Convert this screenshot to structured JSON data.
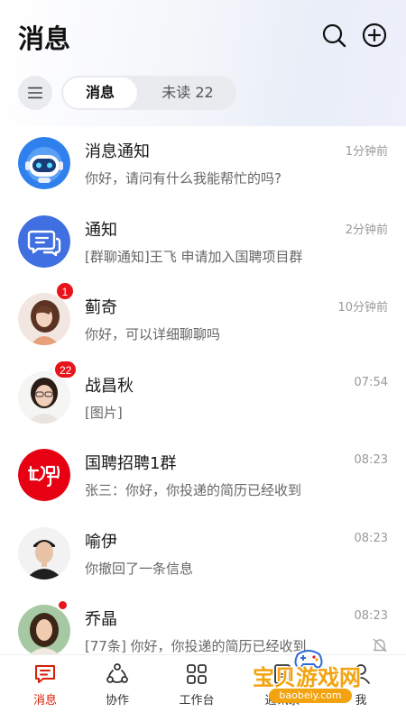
{
  "header": {
    "title": "消息"
  },
  "filter": {
    "tabs": [
      {
        "label": "消息"
      },
      {
        "label": "未读 22"
      }
    ]
  },
  "conversations": [
    {
      "name": "消息通知",
      "preview": "你好，请问有什么我能帮忙的吗?",
      "time": "1分钟前",
      "avatar": "robot-avatar"
    },
    {
      "name": "通知",
      "preview": "[群聊通知]王飞 申请加入国聘项目群",
      "time": "2分钟前",
      "avatar": "chat-notification-avatar"
    },
    {
      "name": "蓟奇",
      "preview": "你好，可以详细聊聊吗",
      "time": "10分钟前",
      "badge": "1",
      "avatar": "user-photo"
    },
    {
      "name": "战昌秋",
      "preview": "[图片]",
      "time": "07:54",
      "badge": "22",
      "avatar": "user-photo"
    },
    {
      "name": "国聘招聘1群",
      "preview": "张三：你好，你投递的简历已经收到",
      "time": "08:23",
      "avatar": "guopin-logo"
    },
    {
      "name": "喻伊",
      "preview": "你撤回了一条信息",
      "time": "08:23",
      "avatar": "user-photo"
    },
    {
      "name": "乔晶",
      "preview": "[77条] 你好，你投递的简历已经收到",
      "time": "08:23",
      "muted": true,
      "avatar": "user-photo"
    }
  ],
  "tabbar": [
    {
      "label": "消息",
      "icon": "message-icon",
      "active": true
    },
    {
      "label": "协作",
      "icon": "collaboration-icon"
    },
    {
      "label": "工作台",
      "icon": "workbench-icon"
    },
    {
      "label": "通讯录",
      "icon": "contacts-icon"
    },
    {
      "label": "我",
      "icon": "profile-icon"
    }
  ],
  "watermark": {
    "text": "宝贝游戏网",
    "url": "baobeiy.com"
  },
  "colors": {
    "accent": "#d81e06",
    "badge": "#e8141b",
    "robot": "#2f80ed",
    "notice": "#3f6fe0"
  }
}
